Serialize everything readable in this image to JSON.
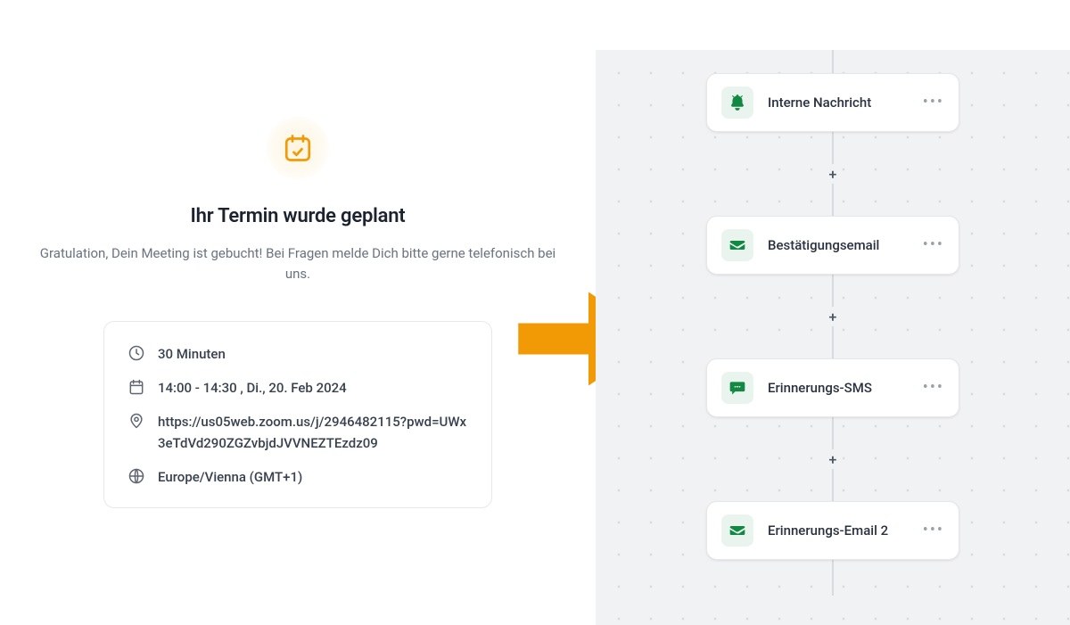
{
  "confirmation": {
    "title": "Ihr Termin wurde geplant",
    "subtitle": "Gratulation, Dein Meeting ist gebucht! Bei Fragen melde Dich bitte gerne telefonisch bei uns.",
    "duration": "30 Minuten",
    "datetime": "14:00 - 14:30 , Di., 20. Feb 2024",
    "location": "https://us05web.zoom.us/j/2946482115?pwd=UWx3eTdVd290ZGZvbjdJVVNEZTEzdz09",
    "timezone": "Europe/Vienna (GMT+1)"
  },
  "workflow": {
    "steps": [
      {
        "icon": "bell",
        "label": "Interne Nachricht"
      },
      {
        "icon": "envelope",
        "label": "Bestätigungsemail"
      },
      {
        "icon": "sms",
        "label": "Erinnerungs-SMS"
      },
      {
        "icon": "envelope",
        "label": "Erinnerungs-Email 2"
      }
    ]
  },
  "colors": {
    "accent_orange": "#f29a05",
    "wf_icon_green": "#138842"
  }
}
